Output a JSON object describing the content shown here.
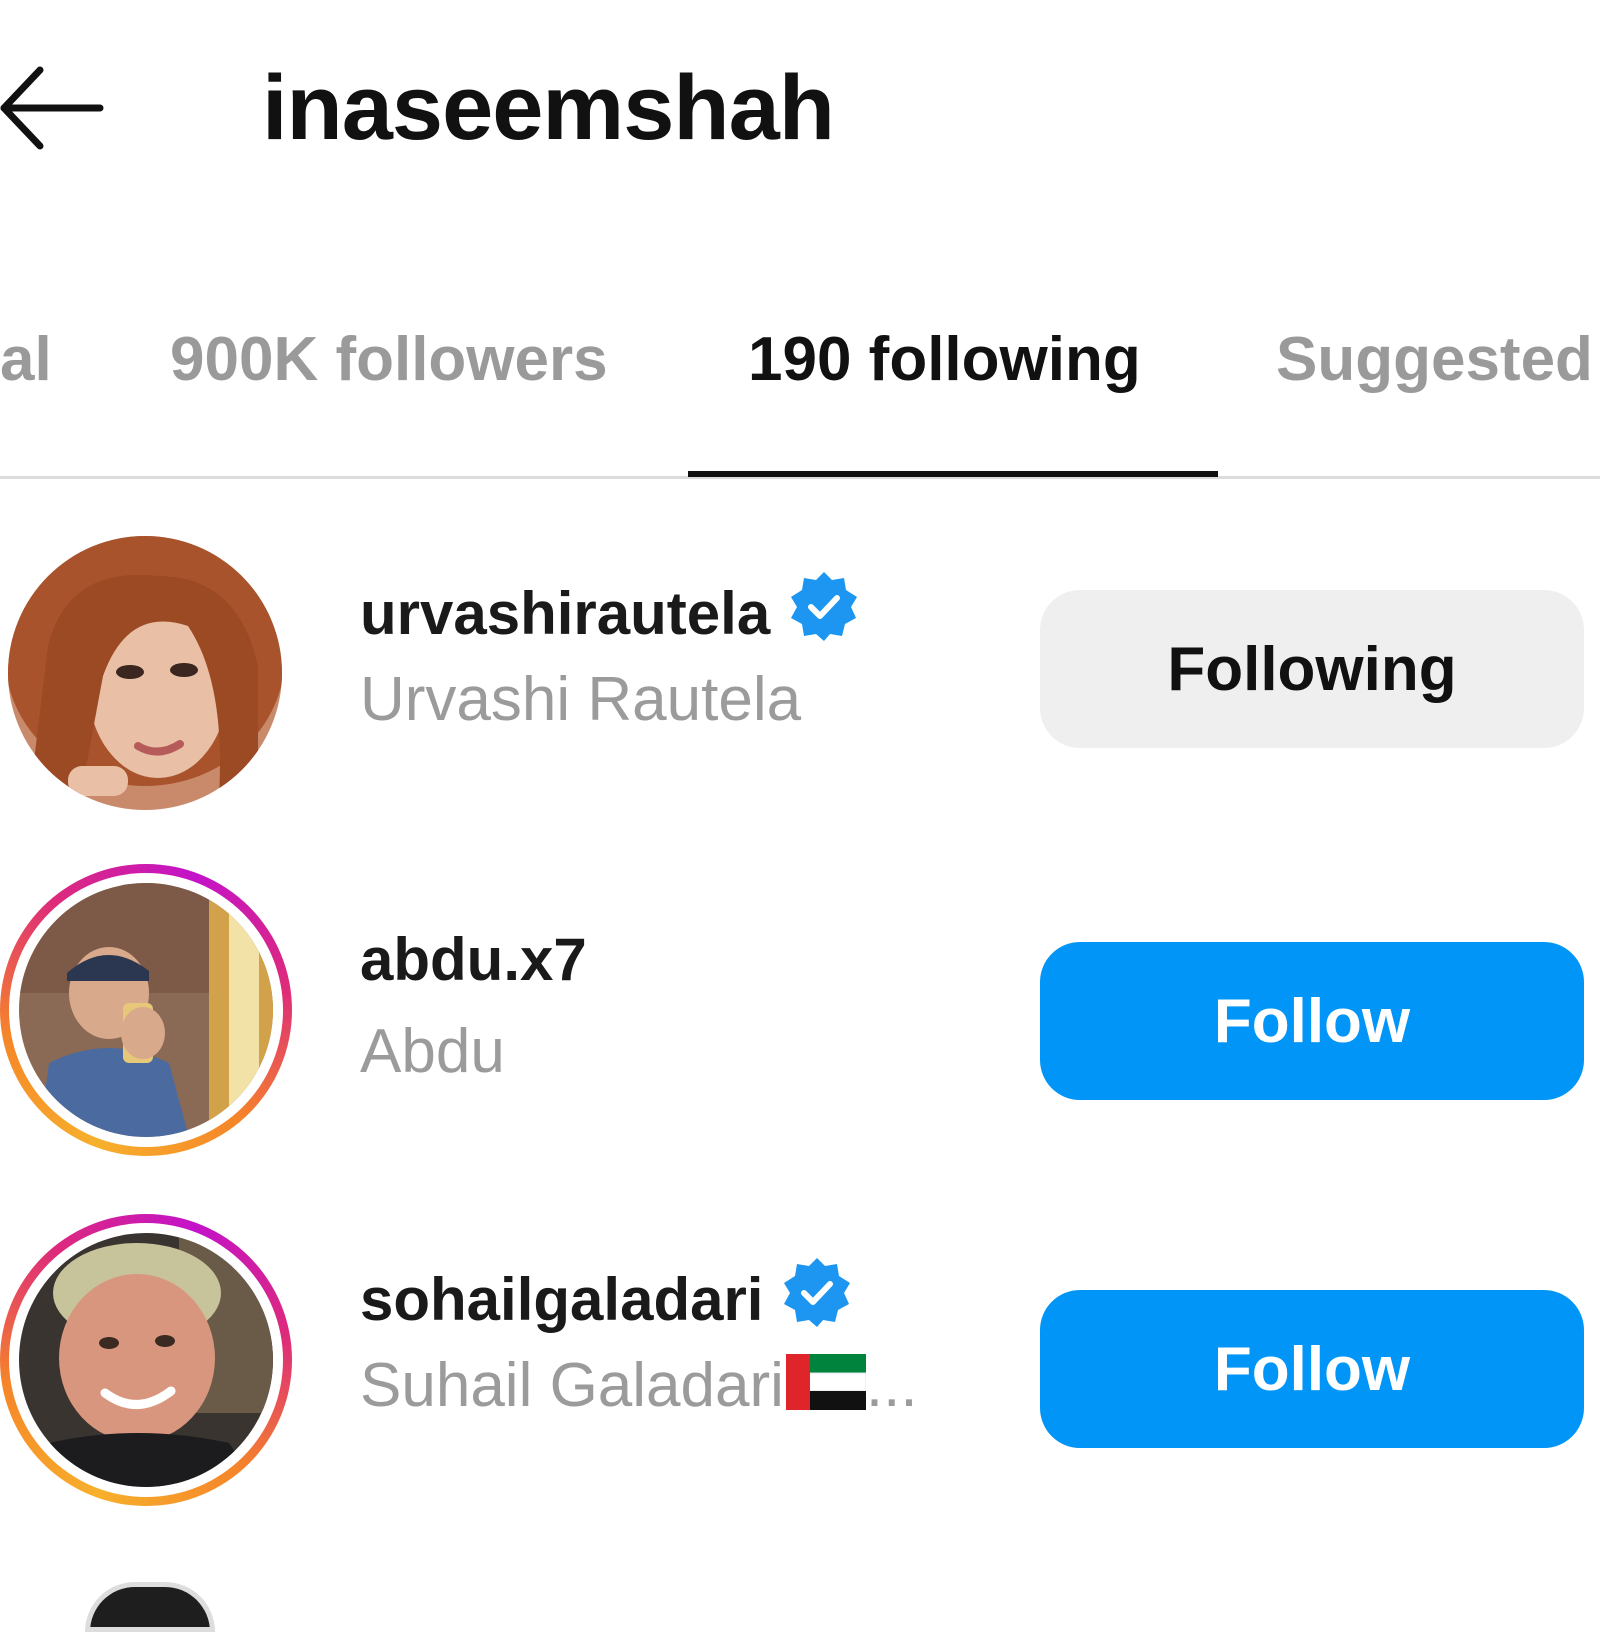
{
  "header": {
    "title": "inaseemshah",
    "back_icon": "arrow-left-icon"
  },
  "tabs": [
    {
      "label": "al",
      "active": false
    },
    {
      "label": "900K followers",
      "active": false
    },
    {
      "label": "190 following",
      "active": true
    },
    {
      "label": "Suggested",
      "active": false
    }
  ],
  "accounts": [
    {
      "username": "urvashirautela",
      "full_name": "Urvashi Rautela",
      "verified": true,
      "story_ring": false,
      "button_label": "Following",
      "button_state": "following"
    },
    {
      "username": "abdu.x7",
      "full_name": "Abdu",
      "verified": false,
      "story_ring": true,
      "button_label": "Follow",
      "button_state": "follow"
    },
    {
      "username": "sohailgaladari",
      "full_name": "Suhail Galadari",
      "name_suffix": "...",
      "flag_icon": "uae-flag-icon",
      "verified": true,
      "story_ring": true,
      "button_label": "Follow",
      "button_state": "follow"
    }
  ],
  "colors": {
    "follow_button": "#0095f6",
    "following_button": "#efefef",
    "verified_badge": "#1c96f0",
    "muted_text": "#9b9b9b",
    "primary_text": "#111111"
  }
}
